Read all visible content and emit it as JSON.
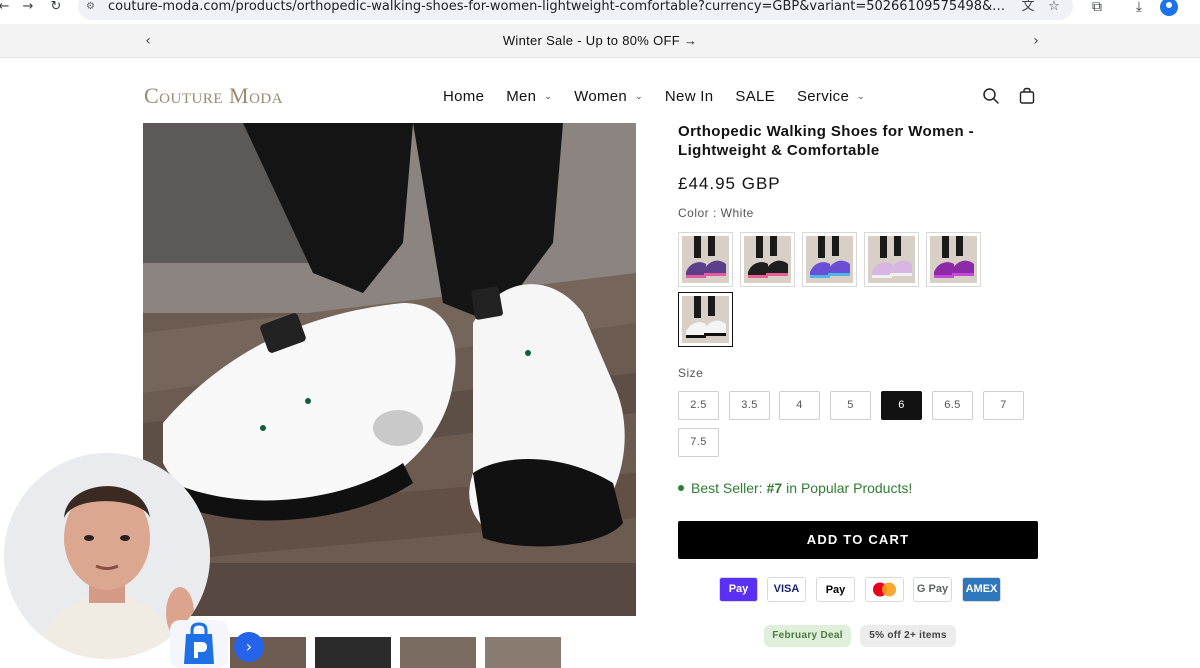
{
  "browser": {
    "url": "couture-moda.com/products/orthopedic-walking-shoes-for-women-lightweight-comfortable?currency=GBP&variant=50266109575498&utm_source=google&utm_..."
  },
  "announcement": {
    "text": "Winter Sale - Up to 80% OFF →"
  },
  "header": {
    "logo": "Couture Moda",
    "nav": [
      {
        "label": "Home",
        "dropdown": false
      },
      {
        "label": "Men",
        "dropdown": true
      },
      {
        "label": "Women",
        "dropdown": true
      },
      {
        "label": "New In",
        "dropdown": false
      },
      {
        "label": "SALE",
        "dropdown": false
      },
      {
        "label": "Service",
        "dropdown": true
      }
    ]
  },
  "product": {
    "title": "Orthopedic Walking Shoes for Women - Lightweight & Comfortable",
    "price": "£44.95 GBP",
    "color_label": "Color : White",
    "color_swatches": [
      {
        "name": "purple-pink",
        "colors": [
          "#5b3f8a",
          "#e65aa2"
        ]
      },
      {
        "name": "black",
        "colors": [
          "#1e1e1e",
          "#e85f95"
        ]
      },
      {
        "name": "blue-purple",
        "colors": [
          "#6a4fd6",
          "#4fb6ea"
        ]
      },
      {
        "name": "light-pink",
        "colors": [
          "#d9b5e3",
          "#f1f1f1"
        ]
      },
      {
        "name": "purple",
        "colors": [
          "#8c2aa8",
          "#c04bd6"
        ]
      },
      {
        "name": "white",
        "colors": [
          "#f4f4f4",
          "#111111"
        ]
      }
    ],
    "selected_color_index": 5,
    "size_label": "Size",
    "sizes": [
      "2.5",
      "3.5",
      "4",
      "5",
      "6",
      "6.5",
      "7",
      "7.5"
    ],
    "selected_size": "6",
    "bestseller": {
      "prefix": "Best Seller:",
      "rank": "#7",
      "suffix": "in Popular Products!"
    },
    "add_to_cart": "ADD TO CART",
    "payment_methods": [
      {
        "name": "shop-pay-icon",
        "label": "Pay",
        "bg": "#5a31f4",
        "fg": "#ffffff"
      },
      {
        "name": "visa-icon",
        "label": "VISA",
        "bg": "#ffffff",
        "fg": "#1a1f71"
      },
      {
        "name": "apple-pay-icon",
        "label": "Pay",
        "bg": "#ffffff",
        "fg": "#000000"
      },
      {
        "name": "mastercard-icon",
        "label": "",
        "bg": "#ffffff",
        "fg": "#000000"
      },
      {
        "name": "google-pay-icon",
        "label": "G Pay",
        "bg": "#ffffff",
        "fg": "#5f6368"
      },
      {
        "name": "amex-icon",
        "label": "AMEX",
        "bg": "#2e77bc",
        "fg": "#ffffff"
      }
    ],
    "badges": [
      {
        "label": "February Deal",
        "bg": "#dff0da",
        "fg": "#4b7a3f"
      },
      {
        "label": "5% off 2+ items",
        "bg": "#ececec",
        "fg": "#444444"
      }
    ]
  },
  "colors": {
    "accent": "#121212",
    "bestseller_green": "#2e7d32",
    "logo": "#9a8a6f"
  }
}
